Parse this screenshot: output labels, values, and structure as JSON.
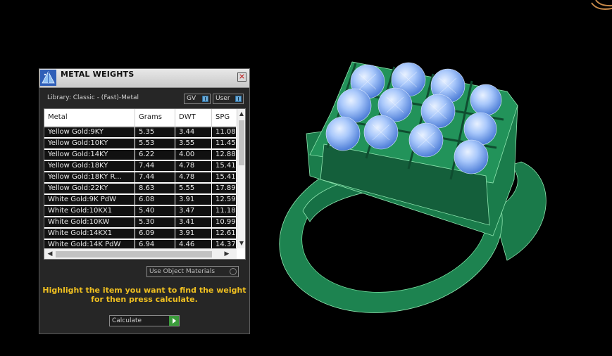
{
  "panel": {
    "title": "METAL WEIGHTS",
    "library_label": "Library: Classic - (Fast)-Metal",
    "toggle_gv": "GV",
    "toggle_user": "User",
    "use_object_materials": "Use Object Materials",
    "hint_line1": "Highlight the item you want to find the weight",
    "hint_line2": "for then press calculate.",
    "calculate_label": "Calculate"
  },
  "table": {
    "columns": [
      "Metal",
      "Grams",
      "DWT",
      "SPG"
    ],
    "rows": [
      [
        "Yellow Gold:9KY",
        "5.35",
        "3.44",
        "11.08"
      ],
      [
        "Yellow Gold:10KY",
        "5.53",
        "3.55",
        "11.45"
      ],
      [
        "Yellow Gold:14KY",
        "6.22",
        "4.00",
        "12.88"
      ],
      [
        "Yellow Gold:18KY",
        "7.44",
        "4.78",
        "15.41"
      ],
      [
        "Yellow Gold:18KY R...",
        "7.44",
        "4.78",
        "15.41"
      ],
      [
        "Yellow Gold:22KY",
        "8.63",
        "5.55",
        "17.89"
      ],
      [
        "White Gold:9K PdW",
        "6.08",
        "3.91",
        "12.59"
      ],
      [
        "White Gold:10KX1",
        "5.40",
        "3.47",
        "11.18"
      ],
      [
        "White Gold:10KW",
        "5.30",
        "3.41",
        "10.99"
      ],
      [
        "White Gold:14KX1",
        "6.09",
        "3.91",
        "12.61"
      ],
      [
        "White Gold:14K PdW",
        "6.94",
        "4.46",
        "14.37"
      ]
    ]
  },
  "colors": {
    "ring_green": "#1f8a55",
    "gem_blue": "#8fb7f5",
    "hint_yellow": "#f0c020"
  },
  "icons": {
    "logo": "pyramid-logo-icon",
    "close": "close-icon"
  }
}
